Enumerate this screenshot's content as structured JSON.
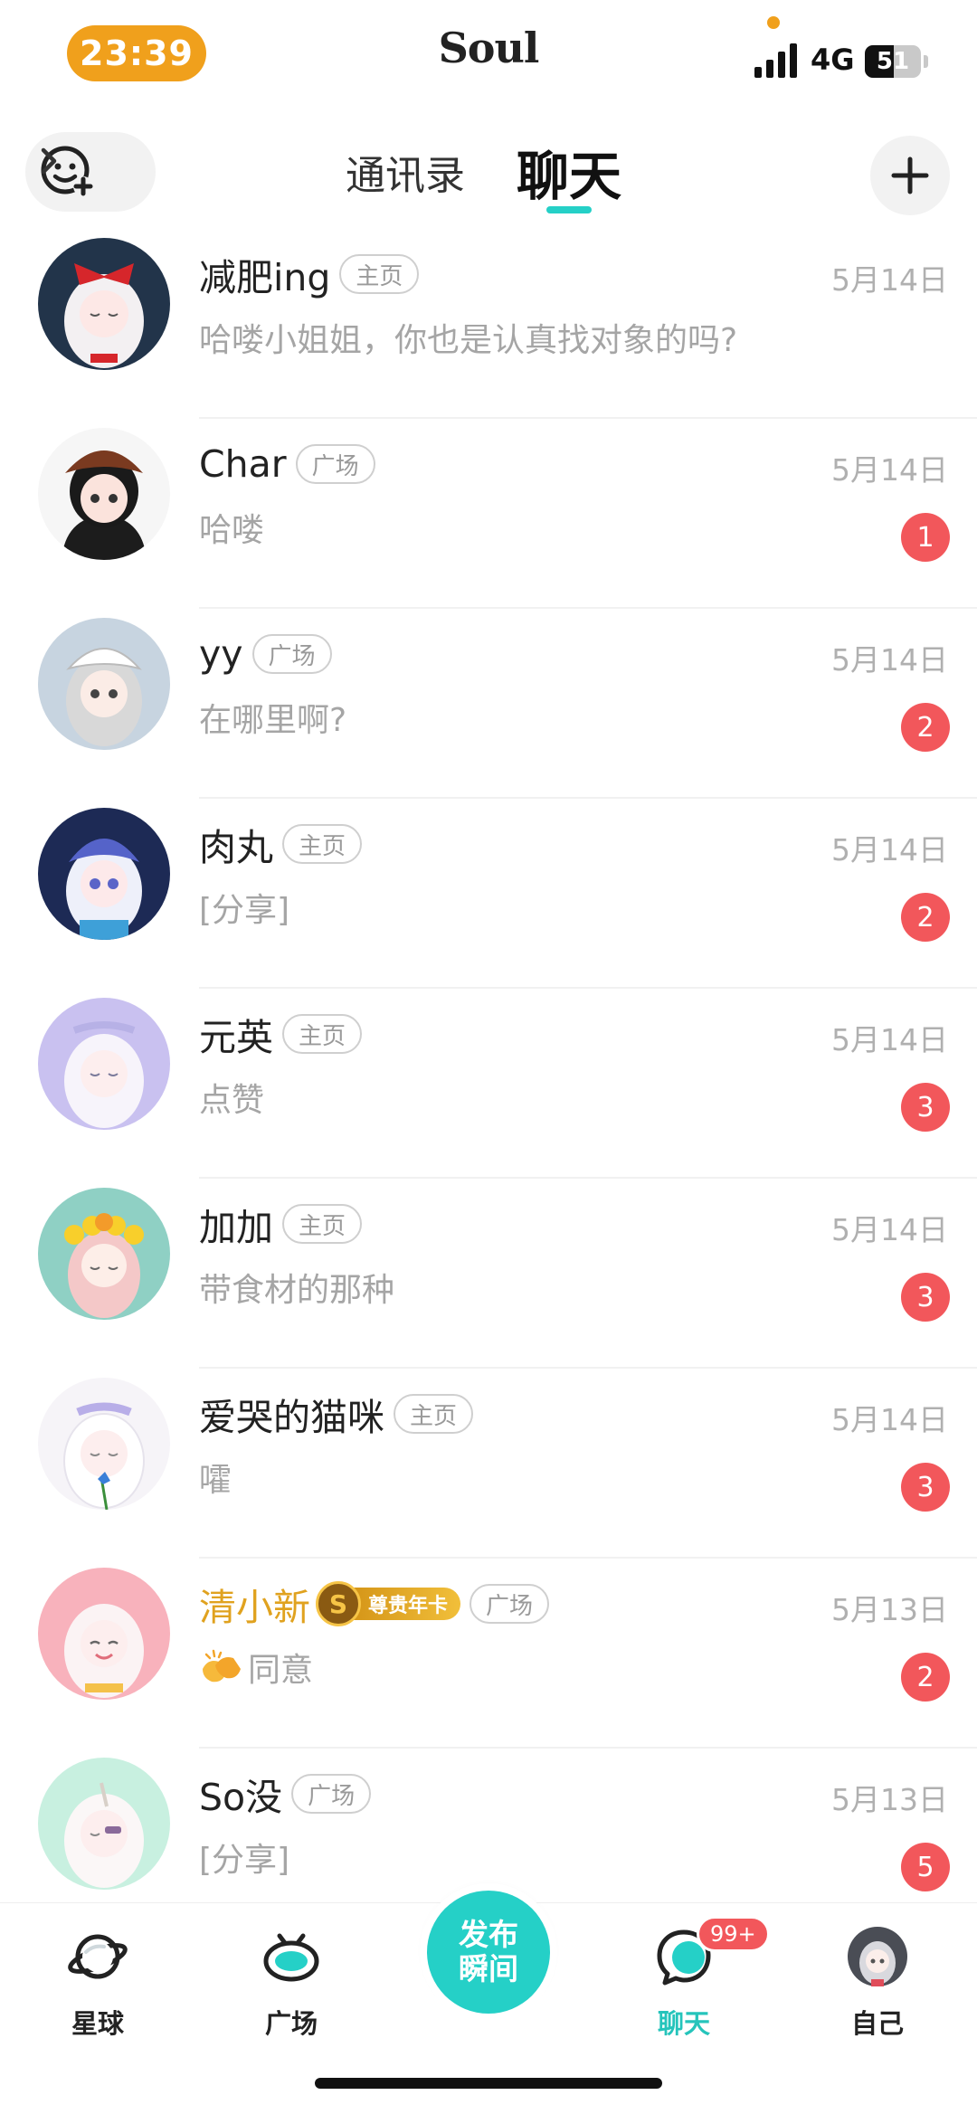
{
  "status_bar": {
    "time": "23:39",
    "app_name": "Soul",
    "network": "4G",
    "battery": "51",
    "battery_level": 0.51,
    "time_color": "#f0a01c"
  },
  "header": {
    "tabs": [
      "通讯录",
      "聊天"
    ],
    "active_tab": "聊天",
    "accent": "#25d0c7"
  },
  "chats": [
    {
      "name": "减肥ing",
      "tag": "主页",
      "date": "5月14日",
      "preview": "哈喽小姐姐，你也是认真找对象的吗?",
      "unread": ""
    },
    {
      "name": "Char",
      "tag": "广场",
      "date": "5月14日",
      "preview": "哈喽",
      "unread": "1"
    },
    {
      "name": "yy",
      "tag": "广场",
      "date": "5月14日",
      "preview": "在哪里啊?",
      "unread": "2"
    },
    {
      "name": "肉丸",
      "tag": "主页",
      "date": "5月14日",
      "preview": "[分享]",
      "unread": "2"
    },
    {
      "name": "元英",
      "tag": "主页",
      "date": "5月14日",
      "preview": "点赞",
      "unread": "3"
    },
    {
      "name": "加加",
      "tag": "主页",
      "date": "5月14日",
      "preview": "带食材的那种",
      "unread": "3"
    },
    {
      "name": "爱哭的猫咪",
      "tag": "主页",
      "date": "5月14日",
      "preview": "嚯",
      "unread": "3"
    },
    {
      "name": "清小新",
      "vip_icon": "S",
      "vip_label": "尊贵年卡",
      "tag": "广场",
      "date": "5月13日",
      "preview": "同意",
      "preview_emoji": "clapping-hands",
      "unread": "2"
    },
    {
      "name": "So没",
      "tag": "广场",
      "date": "5月13日",
      "preview": "[分享]",
      "unread": "5"
    }
  ],
  "bottom_nav": {
    "items": [
      {
        "label": "星球",
        "icon": "planet-icon"
      },
      {
        "label": "广场",
        "icon": "square-icon"
      },
      {
        "label": "聊天",
        "icon": "chat-icon",
        "badge": "99+",
        "active": true
      },
      {
        "label": "自己",
        "icon": "avatar"
      }
    ],
    "publish_label": "发布瞬间",
    "active_color": "#25c4bb",
    "badge_color": "#f2575b"
  }
}
